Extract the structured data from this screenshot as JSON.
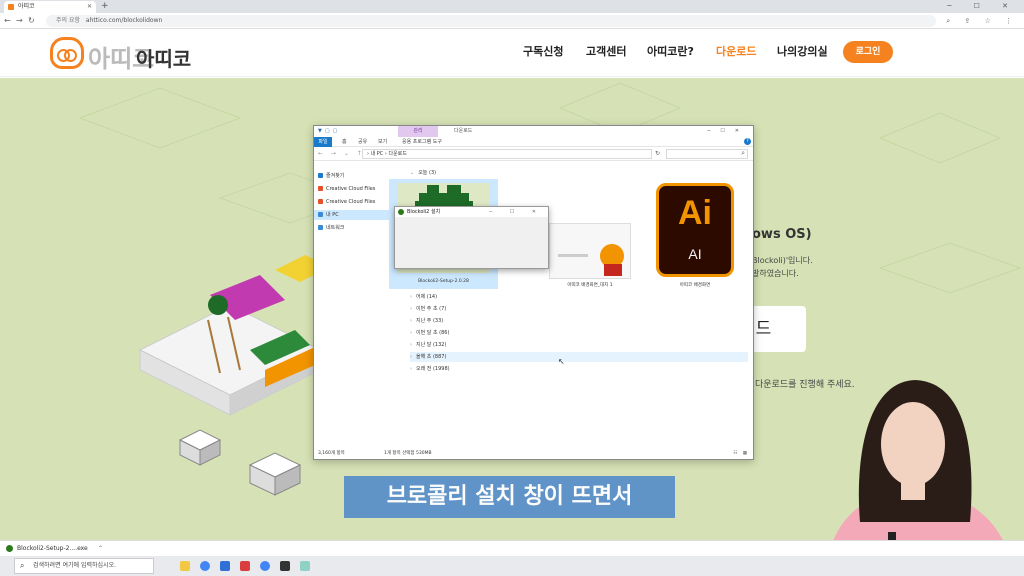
{
  "browser": {
    "tab_title": "아띠코",
    "new_tab": "+",
    "window_controls": "─ ☐ ✕",
    "security": "주의 요함",
    "url": "ahttico.com/blockolidown",
    "toolbar_icons": "⌕ ⇪ ☆ ⋮"
  },
  "site": {
    "logo_ghost": "아띠코",
    "logo_text": "아띠코",
    "nav": [
      "구독신청",
      "고객센터",
      "아띠코란?",
      "다운로드",
      "나의강의실"
    ],
    "nav_active_color": "#f5821f",
    "login": "로그인",
    "bg_fragments": {
      "heading": "ows OS)",
      "line1": "Blockoli)'입니다.",
      "line2": "발하였습니다.",
      "guide": "이드",
      "notice": "다운로드를 진행해 주세요."
    }
  },
  "explorer": {
    "context_tab": "관리",
    "window_name": "다운로드",
    "ribbon": [
      "파일",
      "홈",
      "공유",
      "보기",
      "응용 프로그램 도구"
    ],
    "address_path": "›  내 PC  ›  다운로드",
    "sidebar": [
      {
        "label": "즐겨찾기",
        "color": "#1979ca",
        "selected": false
      },
      {
        "label": "Creative Cloud Files",
        "color": "#e8502a",
        "selected": false
      },
      {
        "label": "Creative Cloud Files",
        "color": "#e8502a",
        "selected": false
      },
      {
        "label": "내 PC",
        "color": "#3a8ad6",
        "selected": true
      },
      {
        "label": "네트워크",
        "color": "#3a8ad6",
        "selected": false
      }
    ],
    "groups": {
      "today": "오늘 (3)",
      "rest": [
        "어제 (14)",
        "이번 주 초 (7)",
        "지난 주 (33)",
        "이번 달 초 (86)",
        "지난 달 (132)",
        "올해 초 (887)",
        "오래 전 (1998)"
      ]
    },
    "files": [
      {
        "name": "Blockoli2-Setup-2.0.28"
      },
      {
        "name": "아띠코 배경화면_대지 1"
      },
      {
        "name": "아띠코 배경화면"
      }
    ],
    "ai_icon": {
      "big": "Ai",
      "small": "AI"
    },
    "status_count": "3,160개 항목",
    "status_selected": "1개 항목 선택함 530MB"
  },
  "dialog": {
    "title": "Blockoli2 설치",
    "controls": "─ ☐ ✕"
  },
  "subtitle": "브로콜리 설치 창이 뜨면서",
  "download": {
    "file": "Blockoli2-Setup-2....exe",
    "chevron": "⌃"
  },
  "taskbar": {
    "search_placeholder": "검색하려면 여기에 입력하십시오."
  }
}
